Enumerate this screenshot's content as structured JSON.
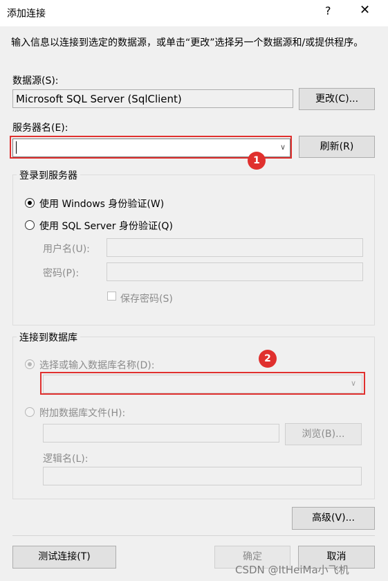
{
  "window": {
    "title": "添加连接",
    "help": "?",
    "close": "✕"
  },
  "description": "输入信息以连接到选定的数据源，或单击“更改”选择另一个数据源和/或提供程序。",
  "datasource": {
    "label": "数据源(S):",
    "value": "Microsoft SQL Server (SqlClient)",
    "change_button": "更改(C)..."
  },
  "server": {
    "label": "服务器名(E):",
    "value": "",
    "refresh_button": "刷新(R)"
  },
  "login": {
    "group": "登录到服务器",
    "windows_auth": "使用 Windows 身份验证(W)",
    "sql_auth": "使用 SQL Server 身份验证(Q)",
    "username_label": "用户名(U):",
    "password_label": "密码(P):",
    "save_password": "保存密码(S)"
  },
  "database": {
    "group": "连接到数据库",
    "select_option": "选择或输入数据库名称(D):",
    "attach_option": "附加数据库文件(H):",
    "browse_button": "浏览(B)...",
    "logical_name_label": "逻辑名(L):"
  },
  "annotations": {
    "badge1": "1",
    "badge2": "2",
    "accent": "#e0302e"
  },
  "buttons": {
    "advanced": "高级(V)...",
    "test": "测试连接(T)",
    "ok": "确定",
    "cancel": "取消"
  },
  "watermark": "CSDN @ItHeiMa小飞机"
}
